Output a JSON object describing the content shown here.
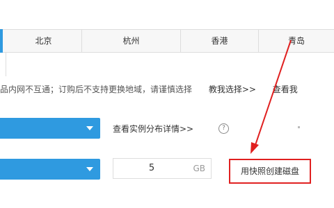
{
  "regions": {
    "tabs": [
      {
        "label": "北京"
      },
      {
        "label": "杭州"
      },
      {
        "label": "香港"
      },
      {
        "label": "青岛"
      }
    ]
  },
  "notice": {
    "text": "品内网不互通；订购后不支持更换地域，请谨慎选择",
    "help_link": "教我选择>>",
    "view_link": "查看我"
  },
  "instance": {
    "distribution_link": "查看实例分布详情>>",
    "help_icon": "?"
  },
  "disk": {
    "quantity": "5",
    "unit": "GB",
    "snapshot_button": "用快照创建磁盘"
  },
  "colors": {
    "accent": "#2f9ae0",
    "annotation_red": "#e02020"
  }
}
